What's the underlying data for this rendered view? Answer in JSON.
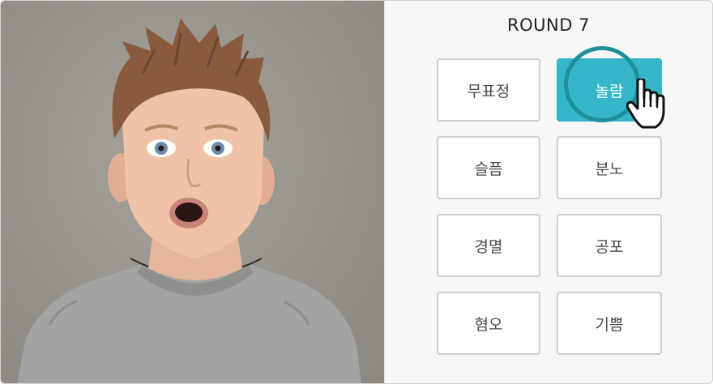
{
  "quiz": {
    "round_label": "ROUND 7",
    "choices": [
      {
        "label": "무표정",
        "selected": false
      },
      {
        "label": "놀람",
        "selected": true
      },
      {
        "label": "슬픔",
        "selected": false
      },
      {
        "label": "분노",
        "selected": false
      },
      {
        "label": "경멸",
        "selected": false
      },
      {
        "label": "공포",
        "selected": false
      },
      {
        "label": "혐오",
        "selected": false
      },
      {
        "label": "기쁨",
        "selected": false
      }
    ]
  },
  "colors": {
    "selected_fill": "#35b6c8",
    "click_ring": "#1f8f9a",
    "photo_background": "#96938d"
  },
  "icons": {
    "cursor": "pointer-hand-icon"
  }
}
